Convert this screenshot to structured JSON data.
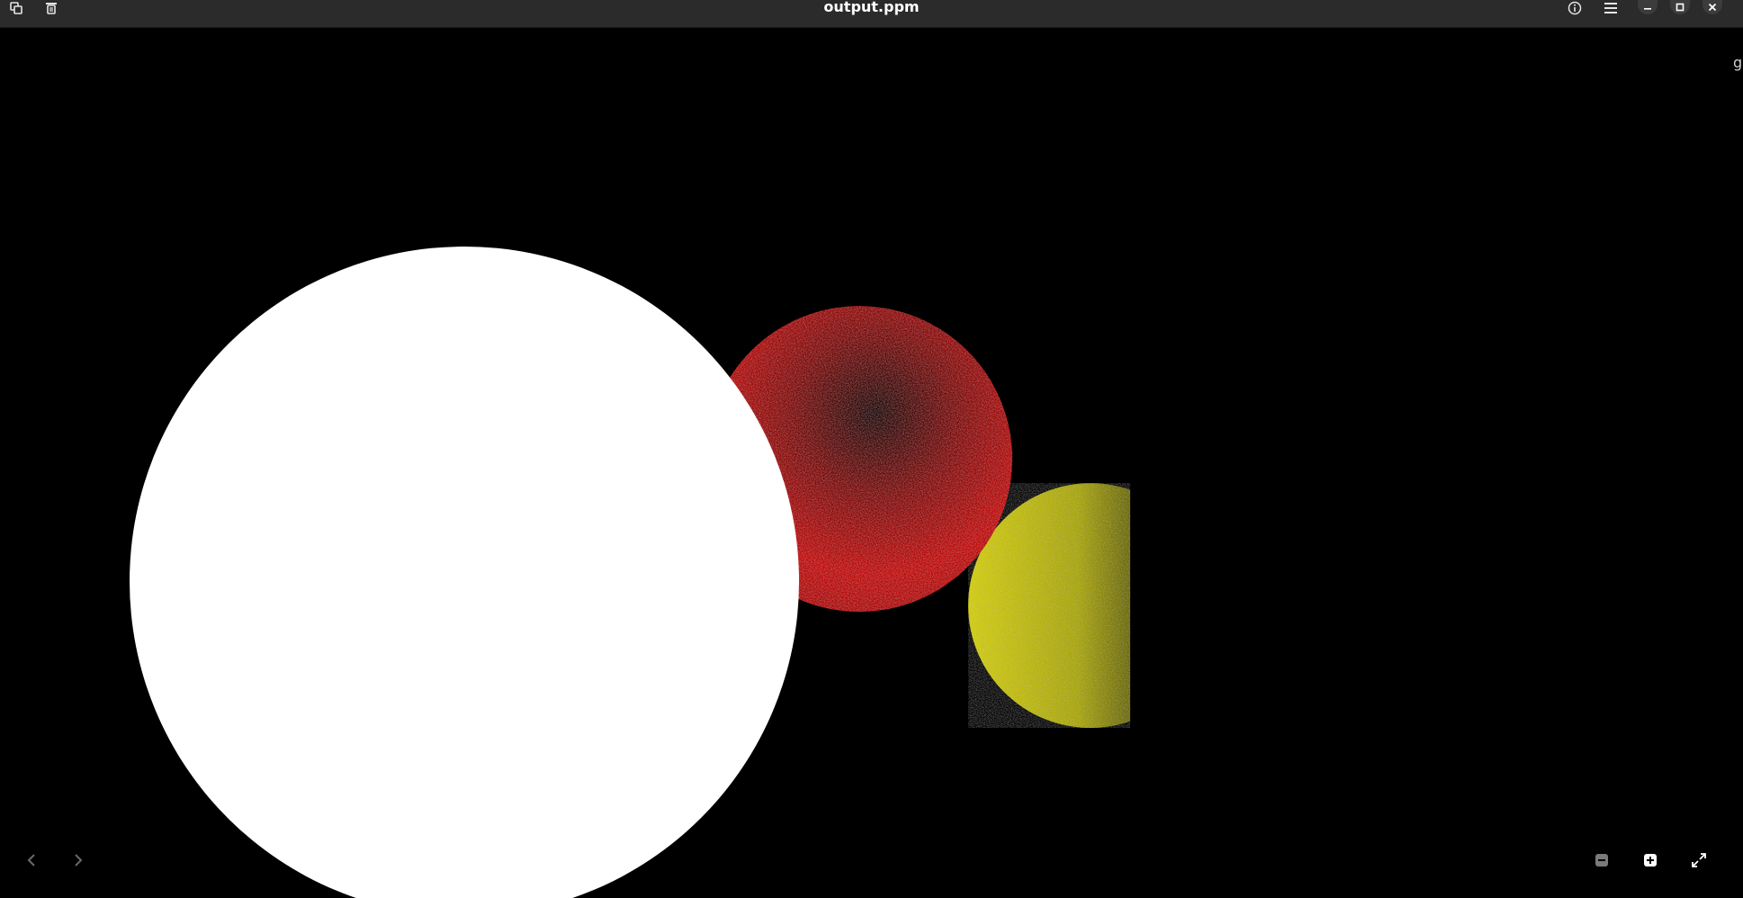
{
  "window": {
    "title": "output.ppm"
  },
  "titlebar": {
    "left_icons": [
      "copy-icon",
      "trash-icon"
    ],
    "right_icons": [
      "info-icon",
      "menu-icon",
      "minimize-icon",
      "maximize-icon",
      "close-icon"
    ]
  },
  "edge_text": "gi",
  "navigation": {
    "icons": [
      "chevron-left-icon",
      "chevron-right-icon"
    ]
  },
  "zoom_controls": {
    "icons": [
      "zoom-out-icon",
      "zoom-in-icon",
      "fullscreen-icon"
    ]
  },
  "colors": {
    "titlebar": "#2b2b2b",
    "background": "#000000",
    "white_sphere": "#ffffff",
    "red_sphere": "#b00000",
    "yellow_sphere": "#c8c800"
  }
}
